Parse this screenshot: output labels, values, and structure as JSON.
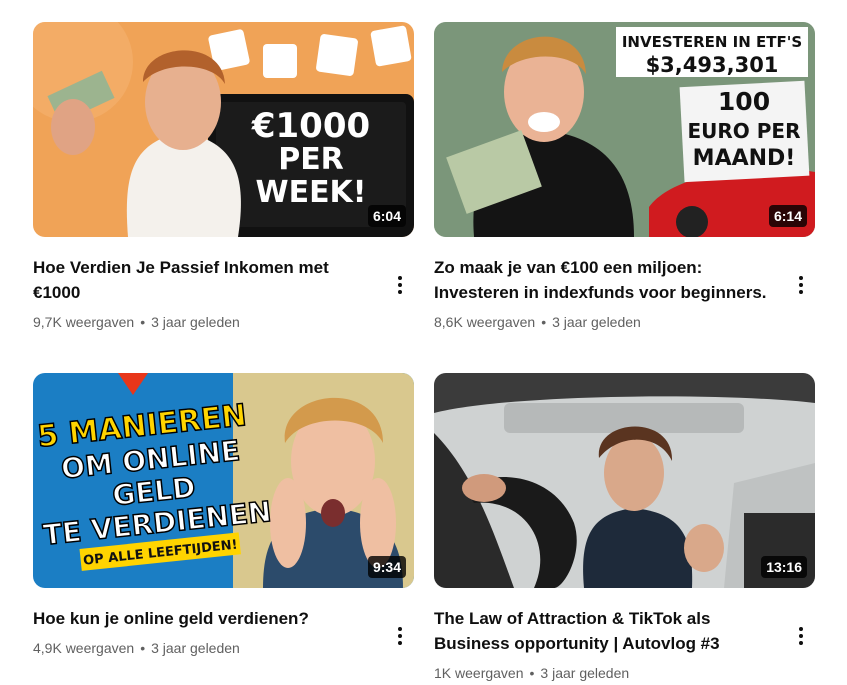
{
  "videos": [
    {
      "title": "Hoe Verdien Je Passief Inkomen met €1000",
      "views": "9,7K weergaven",
      "age": "3 jaar geleden",
      "duration": "6:04",
      "thumb_text": [
        "€1000",
        "PER",
        "WEEK!"
      ]
    },
    {
      "title": "Zo maak je van €100 een miljoen: Investeren in indexfunds voor beginners.",
      "views": "8,6K weergaven",
      "age": "3 jaar geleden",
      "duration": "6:14",
      "thumb_text": [
        "INVESTEREN IN ETF'S",
        "$3,493,301",
        "100",
        "EURO PER",
        "MAAND!"
      ]
    },
    {
      "title": "Hoe kun je online geld verdienen?",
      "views": "4,9K weergaven",
      "age": "3 jaar geleden",
      "duration": "9:34",
      "thumb_text": [
        "5 MANIEREN",
        "OM ONLINE",
        "GELD",
        "TE VERDIENEN",
        "OP ALLE LEEFTIJDEN!"
      ]
    },
    {
      "title": "The Law of Attraction & TikTok als Business opportunity | Autovlog #3",
      "views": "1K weergaven",
      "age": "3 jaar geleden",
      "duration": "13:16"
    }
  ],
  "separator": "•",
  "colors": {
    "title": "#0f0f0f",
    "meta": "#606060",
    "badge_bg": "#000000cc"
  },
  "icons": {
    "more": "more-vert-icon"
  }
}
